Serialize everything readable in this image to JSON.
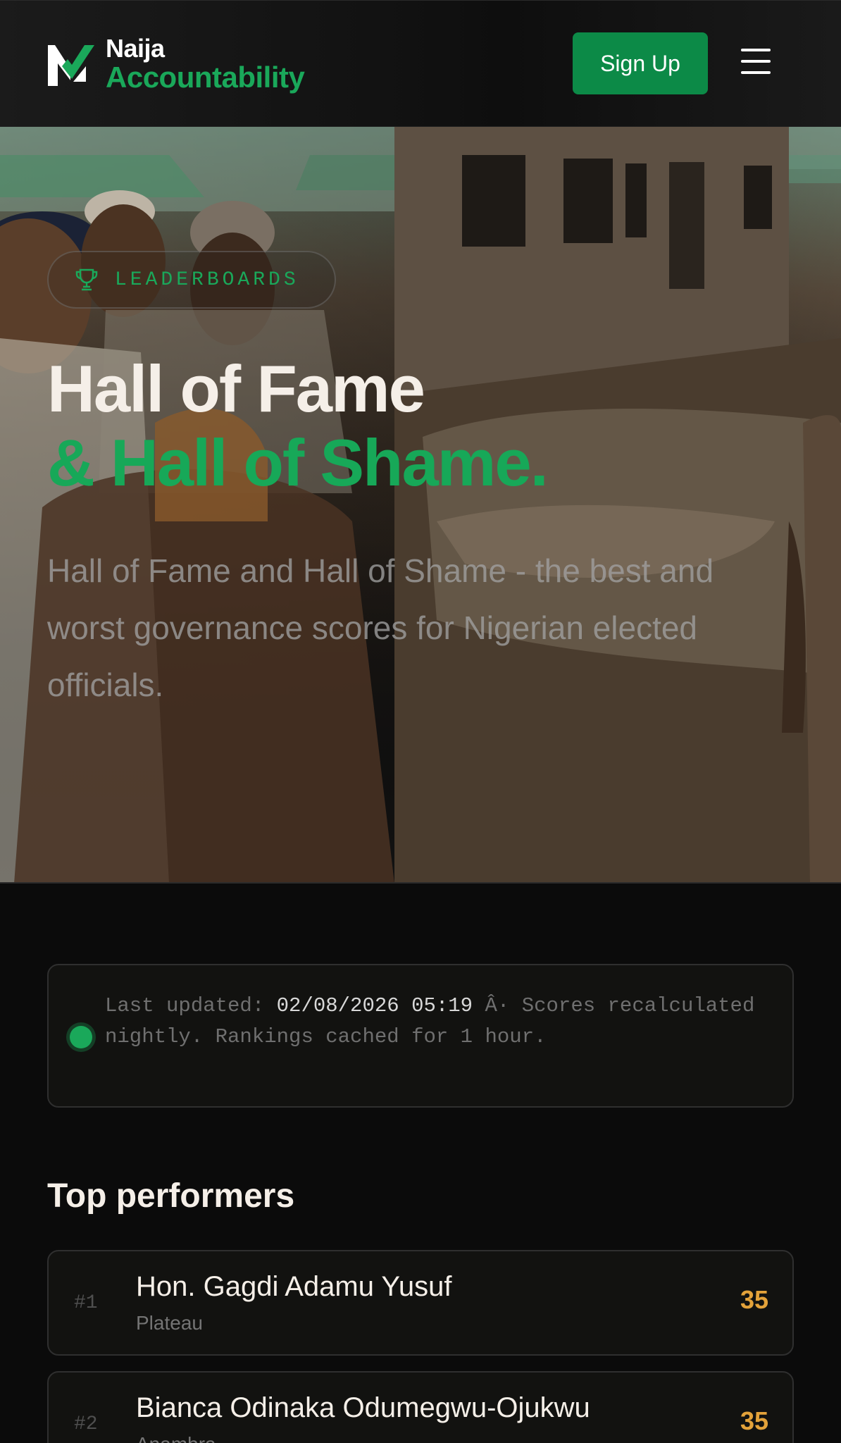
{
  "header": {
    "logo_line1": "Naija",
    "logo_line2": "Accountability",
    "signup_label": "Sign Up",
    "menu_icon": "hamburger-menu-icon"
  },
  "hero": {
    "badge_icon": "trophy-icon",
    "badge_label": "LEADERBOARDS",
    "title_line1": "Hall of Fame",
    "title_line2": "& Hall of Shame.",
    "description": "Hall of Fame and Hall of Shame - the best and worst governance scores for Nigerian elected officials."
  },
  "update": {
    "prefix": "Last updated: ",
    "timestamp": "02/08/2026 05:19",
    "suffix": " Â· Scores recalculated nightly. Rankings cached for 1 hour."
  },
  "top_performers": {
    "title": "Top performers",
    "rows": [
      {
        "rank": "#1",
        "name": "Hon. Gagdi Adamu Yusuf",
        "state": "Plateau",
        "score": "35"
      },
      {
        "rank": "#2",
        "name": "Bianca Odinaka Odumegwu-Ojukwu",
        "state": "Anambra",
        "score": "35"
      }
    ]
  },
  "colors": {
    "brand_green": "#1aa85a",
    "button_green": "#0c8a47",
    "score_amber": "#e3a23a",
    "background": "#0b0b0b"
  }
}
